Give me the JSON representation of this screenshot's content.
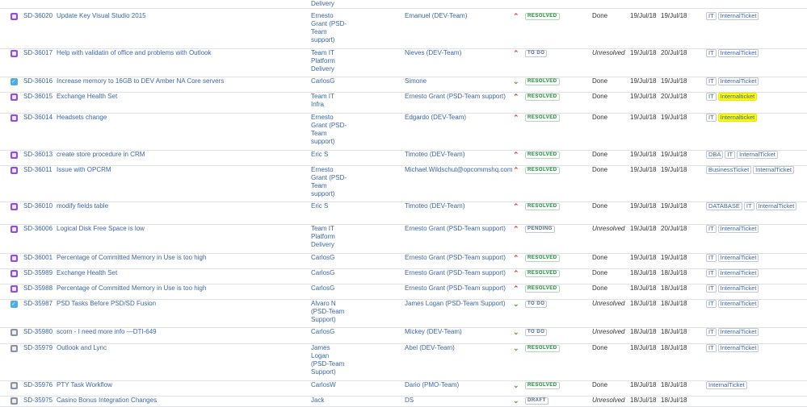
{
  "colors": {
    "link": "#3a66a8",
    "story": "#904ee2",
    "task": "#4bade8",
    "incident": "#8993a4",
    "highlight": "#ffff00"
  },
  "issues": [
    {
      "type": "story",
      "key": "SD-36020",
      "summary": "Update Key Visual Studio 2015",
      "assignee": [
        "Ernesto",
        "Grant (PSD-",
        "Team",
        "support)"
      ],
      "reporter": "Emanuel (DEV-Team)",
      "priority": "up",
      "status": "RESOLVED",
      "resolution": "Done",
      "created": "19/Jul/18",
      "updated": "19/Jul/18",
      "labels": [
        {
          "t": "IT"
        },
        {
          "t": "InternalTicket"
        }
      ]
    },
    {
      "type": "story",
      "key": "SD-36017",
      "summary": "Help with validatin of office and problems with Outlook",
      "assignee": [
        "Team IT",
        "Platform",
        "Delivery"
      ],
      "reporter": "Nieves (DEV-Team)",
      "priority": "up",
      "status": "TO DO",
      "resolution": "Unresolved",
      "created": "19/Jul/18",
      "updated": "20/Jul/18",
      "labels": [
        {
          "t": "IT"
        },
        {
          "t": "InternalTicket"
        }
      ]
    },
    {
      "type": "task",
      "key": "SD-36016",
      "summary": "Increase memory to 16GB to DEV Amber NA Core servers",
      "assignee": [
        "CarlosG"
      ],
      "reporter": "Simone",
      "priority": "down",
      "status": "RESOLVED",
      "resolution": "Done",
      "created": "19/Jul/18",
      "updated": "19/Jul/18",
      "labels": [
        {
          "t": "IT"
        },
        {
          "t": "InternalTicket"
        }
      ]
    },
    {
      "type": "story",
      "key": "SD-36015",
      "summary": "Exchange Health Set",
      "assignee": [
        "Team IT",
        "Infra"
      ],
      "reporter": "Ernesto Grant (PSD-Team support)",
      "priority": "up",
      "status": "RESOLVED",
      "resolution": "Done",
      "created": "19/Jul/18",
      "updated": "20/Jul/18",
      "labels": [
        {
          "t": "IT"
        },
        {
          "t": "Internalticket",
          "hl": true
        }
      ]
    },
    {
      "type": "story",
      "key": "SD-36014",
      "summary": "Headsets change",
      "assignee": [
        "Ernesto",
        "Grant (PSD-",
        "Team",
        "support)"
      ],
      "reporter": "Edgardo (DEV-Team)",
      "priority": "up",
      "status": "RESOLVED",
      "resolution": "Done",
      "created": "19/Jul/18",
      "updated": "19/Jul/18",
      "labels": [
        {
          "t": "IT"
        },
        {
          "t": "Internalticket",
          "hl": true
        }
      ]
    },
    {
      "type": "story",
      "key": "SD-36013",
      "summary": "create store procedure in CRM",
      "assignee": [
        "Eric S"
      ],
      "reporter": "Timoteo (DEV-Team)",
      "priority": "up",
      "status": "RESOLVED",
      "resolution": "Done",
      "created": "19/Jul/18",
      "updated": "19/Jul/18",
      "labels": [
        {
          "t": "DBA"
        },
        {
          "t": "IT"
        },
        {
          "t": "InternalTicket"
        }
      ]
    },
    {
      "type": "story",
      "key": "SD-36011",
      "summary": "Issue with OPCRM",
      "assignee": [
        "Ernesto",
        "Grant (PSD-",
        "Team",
        "support)"
      ],
      "reporter": "Michael.Wildschut@opcommshq.com",
      "priority": "up",
      "status": "RESOLVED",
      "resolution": "Done",
      "created": "19/Jul/18",
      "updated": "19/Jul/18",
      "labels": [
        {
          "t": "BusinessTicket"
        },
        {
          "t": "InternalTicket"
        }
      ]
    },
    {
      "type": "story",
      "key": "SD-36010",
      "summary": "modify fields table",
      "assignee": [
        "Eric S"
      ],
      "reporter": "Timoteo (DEV-Team)",
      "priority": "up",
      "status": "RESOLVED",
      "resolution": "Done",
      "created": "19/Jul/18",
      "updated": "19/Jul/18",
      "labels": [
        {
          "t": "DATABASE"
        },
        {
          "t": "IT"
        },
        {
          "t": "InternalTicket"
        }
      ]
    },
    {
      "type": "story",
      "key": "SD-36006",
      "summary": "Logical Disk Free Space is low",
      "assignee": [
        "Team IT",
        "Platform",
        "Delivery"
      ],
      "reporter": "Ernesto Grant (PSD-Team support)",
      "priority": "up",
      "status": "PENDING",
      "resolution": "Unresolved",
      "created": "19/Jul/18",
      "updated": "20/Jul/18",
      "labels": [
        {
          "t": "IT"
        },
        {
          "t": "InternalTicket"
        }
      ]
    },
    {
      "type": "story",
      "key": "SD-36001",
      "summary": "Percentage of Committed Memory in Use is too high",
      "assignee": [
        "CarlosG"
      ],
      "reporter": "Ernesto Grant (PSD-Team support)",
      "priority": "up",
      "status": "RESOLVED",
      "resolution": "Done",
      "created": "19/Jul/18",
      "updated": "19/Jul/18",
      "labels": [
        {
          "t": "IT"
        },
        {
          "t": "InternalTicket"
        }
      ]
    },
    {
      "type": "story",
      "key": "SD-35989",
      "summary": "Exchange Health Set",
      "assignee": [
        "CarlosG"
      ],
      "reporter": "Ernesto Grant (PSD-Team support)",
      "priority": "up",
      "status": "RESOLVED",
      "resolution": "Done",
      "created": "18/Jul/18",
      "updated": "18/Jul/18",
      "labels": [
        {
          "t": "IT"
        },
        {
          "t": "InternalTicket"
        }
      ]
    },
    {
      "type": "story",
      "key": "SD-35988",
      "summary": "Percentage of Committed Memory in Use is too high",
      "assignee": [
        "CarlosG"
      ],
      "reporter": "Ernesto Grant (PSD-Team support)",
      "priority": "up",
      "status": "RESOLVED",
      "resolution": "Done",
      "created": "18/Jul/18",
      "updated": "18/Jul/18",
      "labels": [
        {
          "t": "IT"
        },
        {
          "t": "InternalTicket"
        }
      ]
    },
    {
      "type": "task",
      "key": "SD-35987",
      "summary": "PSD Tasks Before PSD/SD Fusion",
      "assignee": [
        "Alvaro N",
        "(PSD-Team",
        "Support)"
      ],
      "reporter": "James Logan (PSD-Team Support)",
      "priority": "down",
      "status": "TO DO",
      "resolution": "Unresolved",
      "created": "18/Jul/18",
      "updated": "18/Jul/18",
      "labels": [
        {
          "t": "IT"
        },
        {
          "t": "InternalTicket"
        }
      ]
    },
    {
      "type": "inc",
      "key": "SD-35980",
      "summary": "scorn - I need more info —DTI-649",
      "assignee": [
        "CarlosG"
      ],
      "reporter": "Mickey (DEV-Team)",
      "priority": "down",
      "status": "TO DO",
      "resolution": "Unresolved",
      "created": "18/Jul/18",
      "updated": "18/Jul/18",
      "labels": [
        {
          "t": "IT"
        },
        {
          "t": "InternalTicket"
        }
      ]
    },
    {
      "type": "inc",
      "key": "SD-35979",
      "summary": "Outlook and Lync",
      "assignee": [
        "James",
        "Logan",
        "(PSD-Team",
        "Support)"
      ],
      "reporter": "Abel (DEV-Team)",
      "priority": "down",
      "status": "RESOLVED",
      "resolution": "Done",
      "created": "18/Jul/18",
      "updated": "18/Jul/18",
      "labels": [
        {
          "t": "IT"
        },
        {
          "t": "InternalTicket"
        }
      ]
    },
    {
      "type": "inc",
      "key": "SD-35976",
      "summary": "PTY Task Workflow",
      "assignee": [
        "CarlosW"
      ],
      "reporter": "Dario (PMO-Team)",
      "priority": "down",
      "status": "RESOLVED",
      "resolution": "Done",
      "created": "18/Jul/18",
      "updated": "18/Jul/18",
      "labels": [
        {
          "t": "InternalTicket"
        }
      ]
    },
    {
      "type": "inc",
      "key": "SD-35975",
      "summary": "Casino Bonus Integration Changes",
      "assignee": [
        "Jack"
      ],
      "reporter": "DS",
      "priority": "down",
      "status": "DRAFT",
      "resolution": "Unresolved",
      "created": "18/Jul/18",
      "updated": "18/Jul/18",
      "labels": []
    }
  ],
  "prev_row_tail": "Delivery"
}
